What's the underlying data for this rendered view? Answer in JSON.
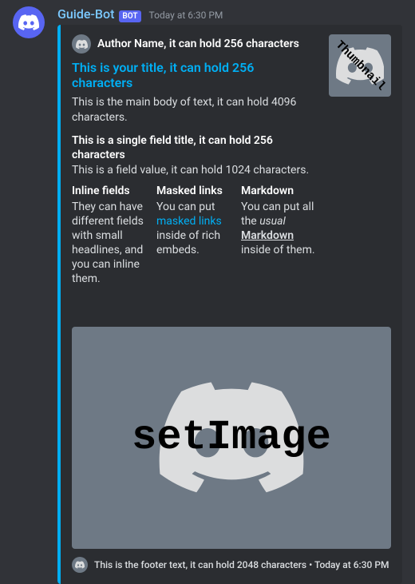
{
  "message": {
    "username": "Guide-Bot",
    "bot_tag": "BOT",
    "timestamp": "Today at 6:30 PM"
  },
  "embed": {
    "accent_color": "#00aff4",
    "author": {
      "name": "Author Name, it can hold 256 characters"
    },
    "title": "This is your title, it can hold 256 characters",
    "description": "This is the main body of text, it can hold 4096 characters.",
    "thumbnail_label": "Thumbnail",
    "fields": [
      {
        "name": "This is a single field title, it can hold 256 characters",
        "value": "This is a field value, it can hold 1024 characters.",
        "inline": false
      },
      {
        "name": "Inline fields",
        "value_pre": "They can have different fields with small headlines, and you can inline them.",
        "inline": true
      },
      {
        "name": "Masked links",
        "value_pre": "You can put ",
        "link_text": "masked links",
        "value_post": " inside of rich embeds.",
        "inline": true
      },
      {
        "name": "Markdown",
        "value_pre": "You can put all the ",
        "italic_text": "usual",
        "value_mid": " ",
        "underline_text": "Markdown",
        "value_post": " inside of them.",
        "inline": true
      }
    ],
    "image_label": "setImage",
    "footer": {
      "text": "This is the footer text, it can hold 2048 characters",
      "separator": " • ",
      "timestamp": "Today at 6:30 PM"
    }
  }
}
